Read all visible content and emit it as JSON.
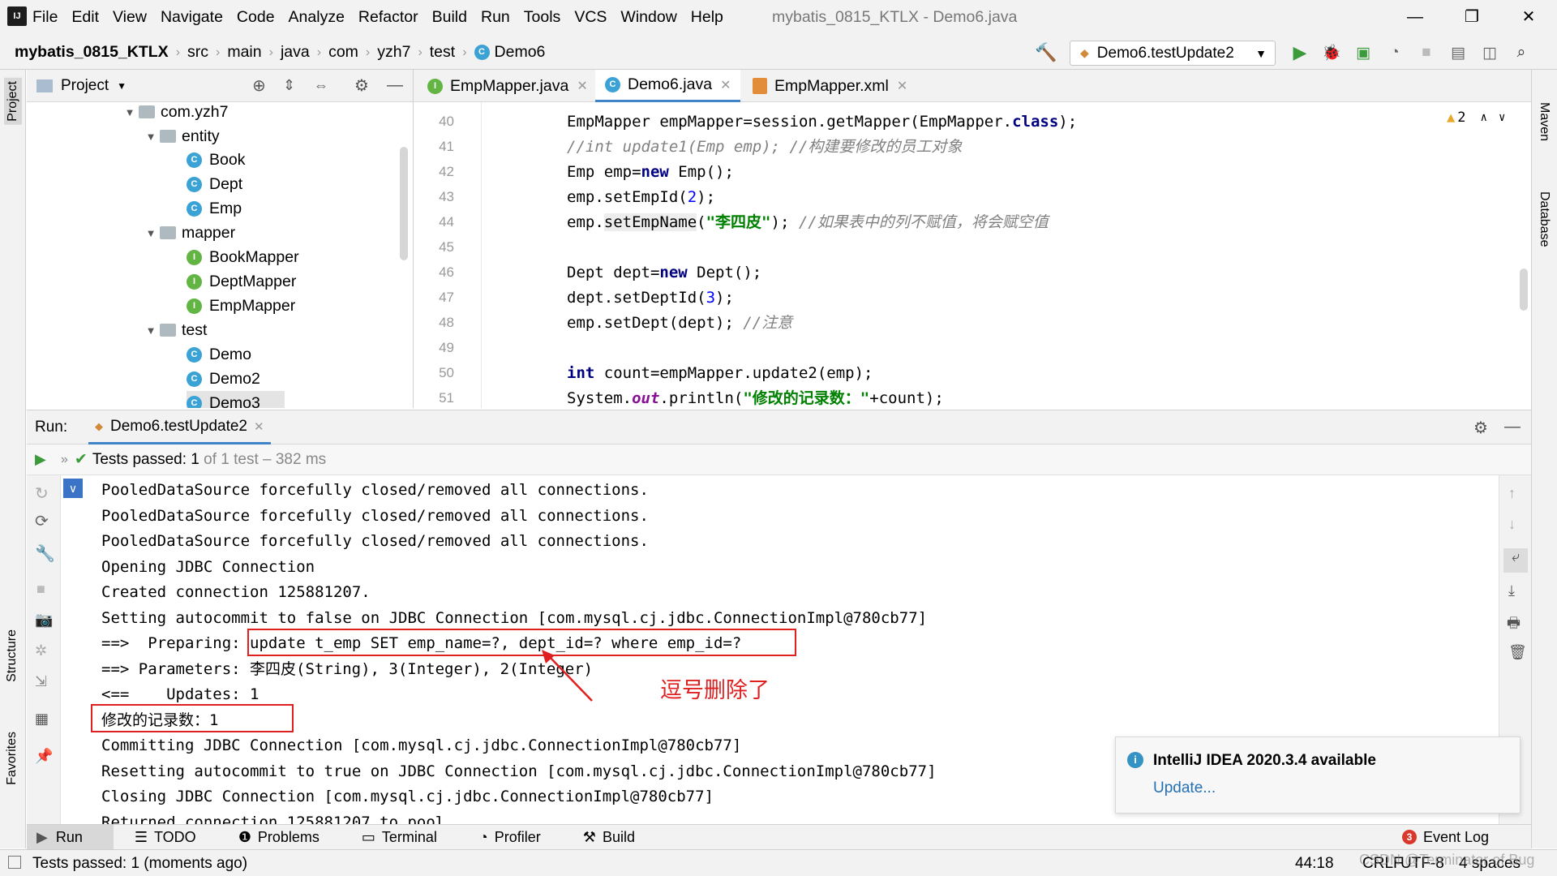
{
  "menu": [
    "File",
    "Edit",
    "View",
    "Navigate",
    "Code",
    "Analyze",
    "Refactor",
    "Build",
    "Run",
    "Tools",
    "VCS",
    "Window",
    "Help"
  ],
  "window_title": "mybatis_0815_KTLX - Demo6.java",
  "breadcrumb": [
    "mybatis_0815_KTLX",
    "src",
    "main",
    "java",
    "com",
    "yzh7",
    "test",
    "Demo6"
  ],
  "run_config": "Demo6.testUpdate2",
  "left_strip": {
    "project": "Project",
    "structure": "Structure",
    "favorites": "Favorites"
  },
  "right_strip": {
    "maven": "Maven",
    "database": "Database"
  },
  "project_panel": {
    "title": "Project"
  },
  "tree": [
    {
      "label": "com.yzh7",
      "type": "folder",
      "expanded": true
    },
    {
      "label": "entity",
      "type": "folder",
      "expanded": true
    },
    {
      "label": "Book",
      "type": "class"
    },
    {
      "label": "Dept",
      "type": "class"
    },
    {
      "label": "Emp",
      "type": "class"
    },
    {
      "label": "mapper",
      "type": "folder",
      "expanded": true
    },
    {
      "label": "BookMapper",
      "type": "interface"
    },
    {
      "label": "DeptMapper",
      "type": "interface"
    },
    {
      "label": "EmpMapper",
      "type": "interface"
    },
    {
      "label": "test",
      "type": "folder",
      "expanded": true
    },
    {
      "label": "Demo",
      "type": "class"
    },
    {
      "label": "Demo2",
      "type": "class"
    },
    {
      "label": "Demo3",
      "type": "class"
    }
  ],
  "editor_tabs": [
    {
      "label": "EmpMapper.java",
      "active": false
    },
    {
      "label": "Demo6.java",
      "active": true
    },
    {
      "label": "EmpMapper.xml",
      "active": false
    }
  ],
  "warnings_count": "2",
  "line_numbers": [
    "40",
    "41",
    "42",
    "43",
    "44",
    "45",
    "46",
    "47",
    "48",
    "49",
    "50",
    "51"
  ],
  "code": {
    "l40_a": "EmpMapper empMapper=session.getMapper(EmpMapper.",
    "l40_kw": "class",
    "l40_b": ");",
    "l41": "//int update1(Emp emp); //构建要修改的员工对象",
    "l42_a": "Emp emp=",
    "l42_kw": "new",
    "l42_b": " Emp();",
    "l43_a": "emp.setEmpId(",
    "l43_n": "2",
    "l43_b": ");",
    "l44_a": "emp.",
    "l44_m": "setEmpName",
    "l44_b": "(",
    "l44_s": "\"李四皮\"",
    "l44_c": "); ",
    "l44_cmt": "//如果表中的列不赋值，将会赋空值",
    "l46_a": "Dept dept=",
    "l46_kw": "new",
    "l46_b": " Dept();",
    "l47_a": "dept.setDeptId(",
    "l47_n": "3",
    "l47_b": ");",
    "l48_a": "emp.setDept(dept); ",
    "l48_cmt": "//注意",
    "l50_kw": "int",
    "l50_b": " count=empMapper.update2(emp);",
    "l51_a": "System.",
    "l51_out": "out",
    "l51_b": ".println(",
    "l51_s": "\"修改的记录数：\"",
    "l51_c": "+count);"
  },
  "run_panel": {
    "label": "Run:",
    "tab": "Demo6.testUpdate2",
    "tests_passed_bold": "Tests passed: 1",
    "tests_passed_rest": " of 1 test – 382 ms"
  },
  "console": [
    "PooledDataSource forcefully closed/removed all connections.",
    "PooledDataSource forcefully closed/removed all connections.",
    "PooledDataSource forcefully closed/removed all connections.",
    "Opening JDBC Connection",
    "Created connection 125881207.",
    "Setting autocommit to false on JDBC Connection [com.mysql.cj.jdbc.ConnectionImpl@780cb77]",
    "==>  Preparing: update t_emp SET emp_name=?, dept_id=? where emp_id=?",
    "==> Parameters: 李四皮(String), 3(Integer), 2(Integer)",
    "<==    Updates: 1",
    "修改的记录数：1",
    "Committing JDBC Connection [com.mysql.cj.jdbc.ConnectionImpl@780cb77]",
    "Resetting autocommit to true on JDBC Connection [com.mysql.cj.jdbc.ConnectionImpl@780cb77]",
    "Closing JDBC Connection [com.mysql.cj.jdbc.ConnectionImpl@780cb77]",
    "Returned connection 125881207 to pool."
  ],
  "annotation": "逗号删除了",
  "notification": {
    "title": "IntelliJ IDEA 2020.3.4 available",
    "link": "Update..."
  },
  "bottom_tabs": [
    "Run",
    "TODO",
    "Problems",
    "Terminal",
    "Profiler",
    "Build"
  ],
  "event_log": "Event Log",
  "event_log_count": "3",
  "status": {
    "message": "Tests passed: 1 (moments ago)",
    "position": "44:18",
    "line_sep": "CRLF",
    "encoding": "UTF-8",
    "indent": "4 spaces",
    "watermark": "CSDN @Terminator of Bug"
  },
  "colors": {
    "accent": "#4083c9",
    "annotation": "#e02020",
    "keyword": "#000080",
    "string": "#008000",
    "comment": "#808080"
  }
}
